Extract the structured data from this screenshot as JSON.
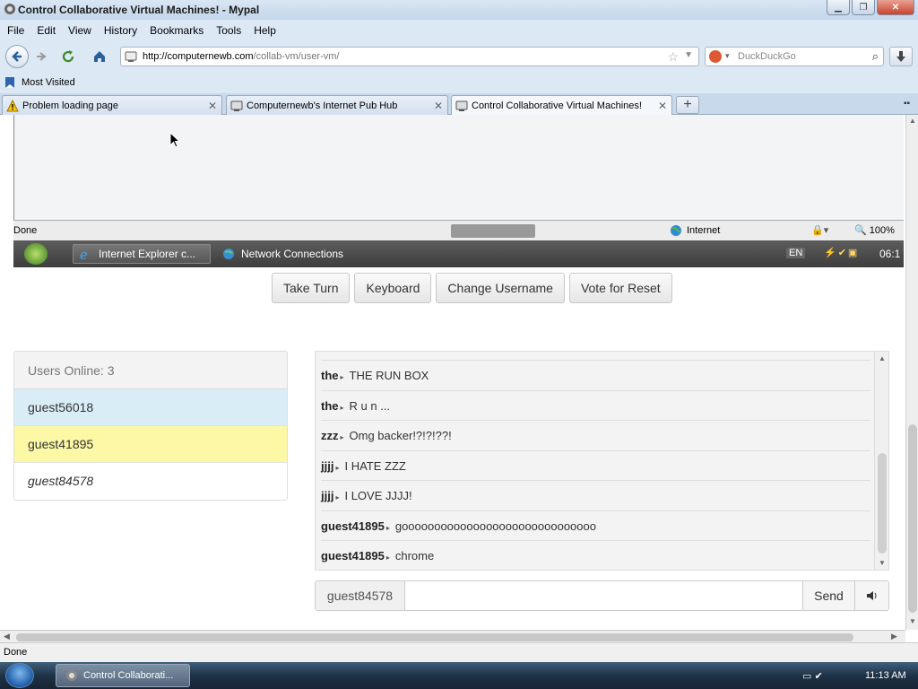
{
  "window": {
    "title": "Control Collaborative Virtual Machines! - Mypal",
    "controls": {
      "minimize": "▁",
      "maximize": "❐",
      "close": "✕"
    }
  },
  "menu": {
    "items": [
      {
        "label": "File"
      },
      {
        "label": "Edit"
      },
      {
        "label": "View"
      },
      {
        "label": "History"
      },
      {
        "label": "Bookmarks"
      },
      {
        "label": "Tools"
      },
      {
        "label": "Help"
      }
    ]
  },
  "nav": {
    "url_host": "http://computernewb.com",
    "url_path": "/collab-vm/user-vm/",
    "search_placeholder": "DuckDuckGo"
  },
  "bookmarks": {
    "most_visited": "Most Visited"
  },
  "tabs": [
    {
      "label": "Problem loading page"
    },
    {
      "label": "Computernewb's Internet Pub Hub"
    },
    {
      "label": "Control Collaborative Virtual Machines!"
    }
  ],
  "vm": {
    "ie_status": "Done",
    "zone": "Internet",
    "zoom": "100%",
    "taskbar_items": [
      {
        "label": "Internet Explorer c..."
      },
      {
        "label": "Network Connections"
      }
    ],
    "lang": "EN",
    "clock": "06:1"
  },
  "controls": {
    "take_turn": "Take Turn",
    "keyboard": "Keyboard",
    "change_username": "Change Username",
    "vote_reset": "Vote for Reset"
  },
  "users": {
    "header": "Users Online: 3",
    "list": [
      {
        "name": "guest56018",
        "color": "#d9edf7"
      },
      {
        "name": "guest41895",
        "color": "#fcf8a6"
      },
      {
        "name": "guest84578",
        "color": "#ffffff"
      }
    ]
  },
  "chat": {
    "messages": [
      {
        "user": "the",
        "text": "THE RUN BOX"
      },
      {
        "user": "the",
        "text": "R u n ..."
      },
      {
        "user": "zzz",
        "text": "Omg backer!?!?!??!"
      },
      {
        "user": "jjjj",
        "text": "I HATE ZZZ"
      },
      {
        "user": "jjjj",
        "text": "I LOVE JJJJ!"
      },
      {
        "user": "guest41895",
        "text": "goooooooooooooooooooooooooooooo"
      },
      {
        "user": "guest41895",
        "text": "chrome"
      }
    ],
    "username": "guest84578",
    "input_value": "",
    "send_label": "Send"
  },
  "browser_status": "Done",
  "host_taskbar": {
    "task_label": "Control Collaborati...",
    "clock": "11:13 AM"
  }
}
